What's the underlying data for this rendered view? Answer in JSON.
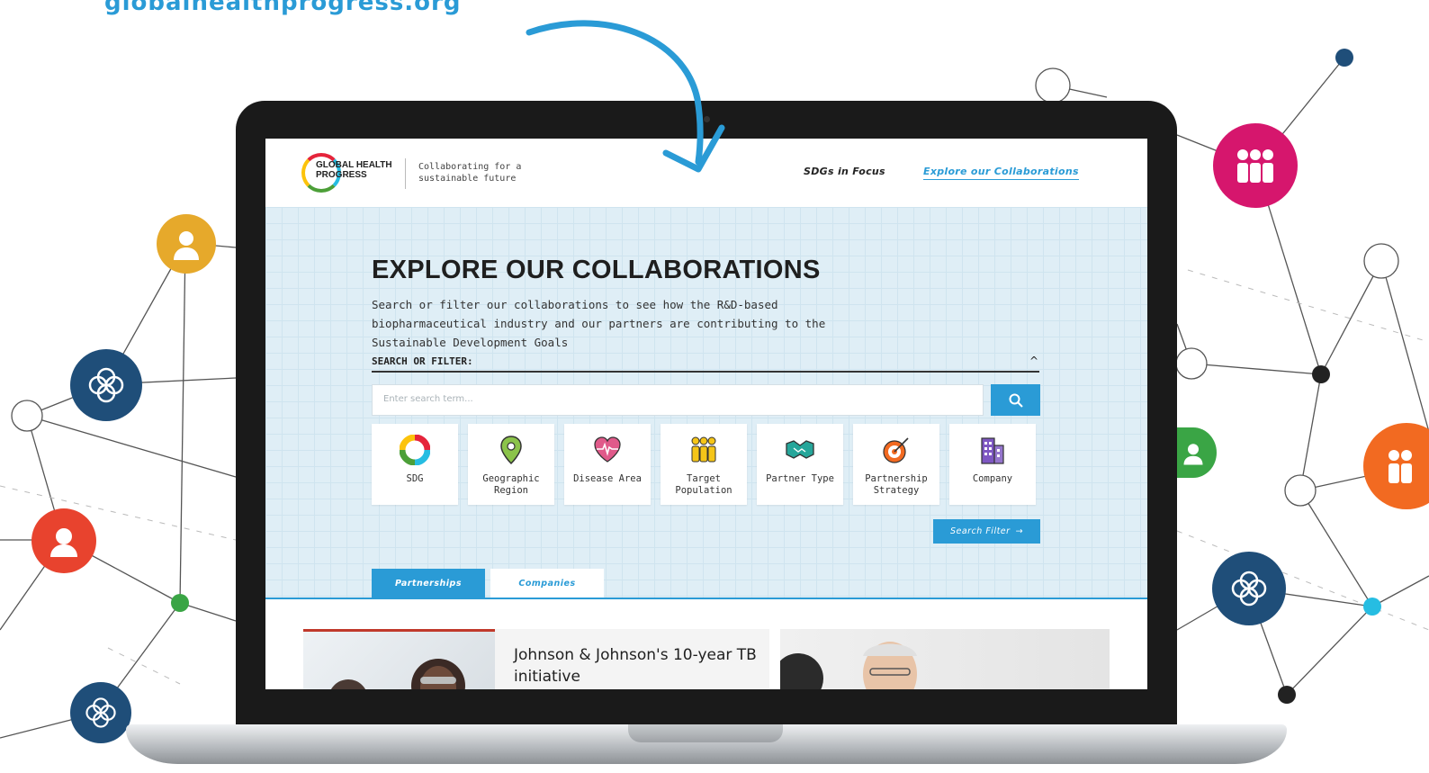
{
  "caption": {
    "url": "globalhealthprogress.org"
  },
  "site": {
    "logo_text_line1": "GLOBAL HEALTH",
    "logo_text_line2": "PROGRESS",
    "tagline": "Collaborating for a sustainable future",
    "nav": {
      "sdgs": "SDGs in Focus",
      "explore": "Explore our Collaborations"
    }
  },
  "hero": {
    "title": "EXPLORE OUR COLLABORATIONS",
    "lead": "Search or filter our collaborations to see how the R&D-based biopharmaceutical industry and our partners are contributing to the Sustainable Development Goals",
    "search_label": "SEARCH OR FILTER:",
    "search_placeholder": "Enter search term...",
    "filters": [
      {
        "label": "SDG",
        "icon": "sdg-wheel-icon"
      },
      {
        "label": "Geographic Region",
        "icon": "map-pin-icon"
      },
      {
        "label": "Disease Area",
        "icon": "heart-pulse-icon"
      },
      {
        "label": "Target Population",
        "icon": "people-icon"
      },
      {
        "label": "Partner Type",
        "icon": "handshake-icon"
      },
      {
        "label": "Partnership Strategy",
        "icon": "target-icon"
      },
      {
        "label": "Company",
        "icon": "building-icon"
      }
    ],
    "filter_button": "Search Filter"
  },
  "tabs": {
    "partnerships": "Partnerships",
    "companies": "Companies"
  },
  "cards": [
    {
      "title": "Johnson & Johnson's 10-year TB initiative"
    }
  ],
  "colors": {
    "accent": "#2a9bd6",
    "hero_bg": "#dfeef6",
    "badge_navy": "#1f4e79",
    "badge_magenta": "#d6166d",
    "badge_gold": "#e6a92b",
    "badge_red": "#e8432e",
    "badge_orange": "#f26a21",
    "badge_green": "#3aa545"
  }
}
